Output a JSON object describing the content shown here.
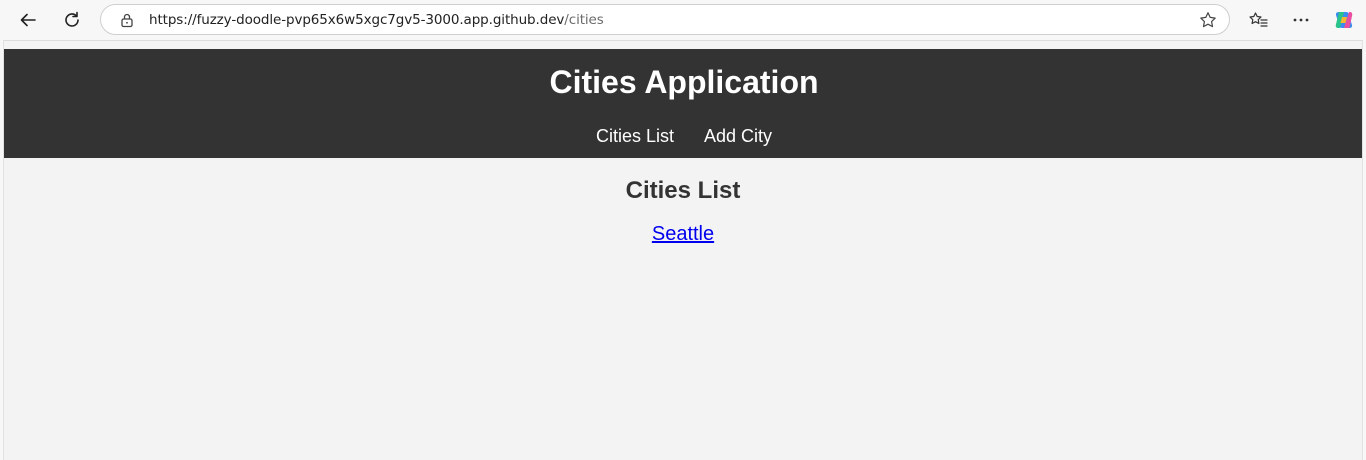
{
  "browser": {
    "url_host": "https://fuzzy-doodle-pvp65x6w5xgc7gv5-3000.app.github.dev",
    "url_path": "/cities"
  },
  "header": {
    "title": "Cities Application",
    "nav": [
      {
        "label": "Cities List"
      },
      {
        "label": "Add City"
      }
    ]
  },
  "main": {
    "heading": "Cities List",
    "cities": [
      {
        "name": "Seattle"
      }
    ]
  },
  "colors": {
    "header_bg": "#333333",
    "page_bg": "#f3f3f3",
    "link": "#0000ee"
  }
}
